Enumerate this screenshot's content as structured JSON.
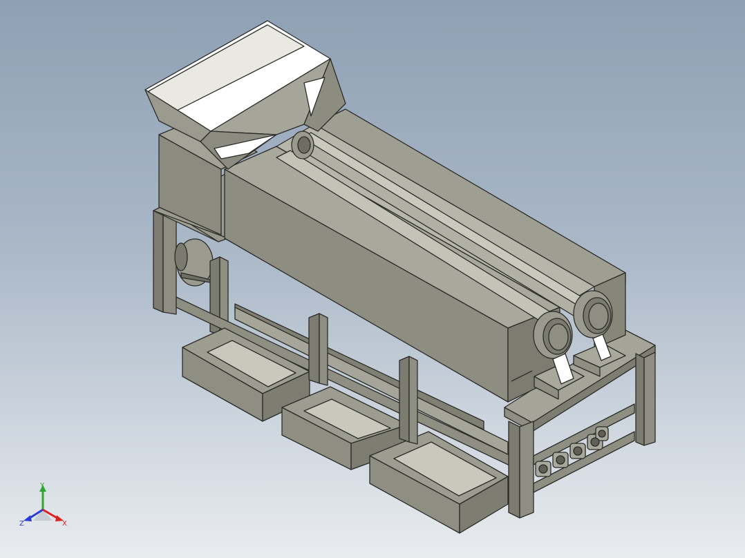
{
  "viewport": {
    "background_top": "#8fa0b4",
    "background_bottom": "#e9ecef"
  },
  "model": {
    "body_color": "#8a8a7c",
    "edge_color": "#2b2b28",
    "hopper_inner_color": "#ffffff"
  },
  "triad": {
    "x_label": "X",
    "y_label": "Y",
    "z_label": "Z",
    "x_color": "#e01f1f",
    "y_color": "#2ea82e",
    "z_color": "#2a3bd6"
  }
}
